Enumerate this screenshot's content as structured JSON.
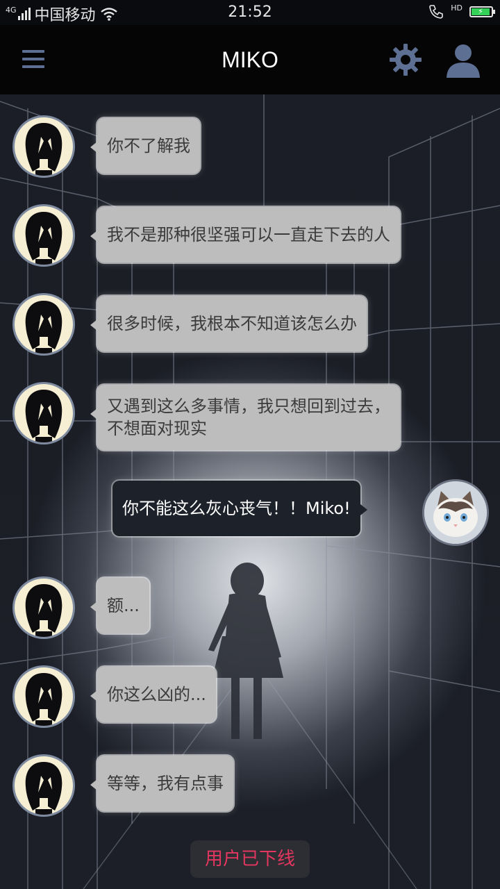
{
  "status_bar": {
    "network": "4G",
    "carrier": "中国移动",
    "time": "21:52",
    "hd": "HD",
    "battery_icon": "battery-charging-icon",
    "wifi_icon": "wifi-icon"
  },
  "header": {
    "title": "MIKO",
    "menu_icon": "menu-icon",
    "settings_icon": "gear-icon",
    "profile_icon": "user-icon"
  },
  "messages": [
    {
      "sender": "miko",
      "lines": [
        "你不了解我"
      ]
    },
    {
      "sender": "miko",
      "lines": [
        "我不是那种很坚强可以一直走下去的人"
      ]
    },
    {
      "sender": "miko",
      "lines": [
        "很多时候，我根本不知道该怎么办"
      ]
    },
    {
      "sender": "miko",
      "lines": [
        "又遇到这么多事情，我只想回到过去，",
        "不想面对现实"
      ]
    },
    {
      "sender": "user",
      "lines": [
        "你不能这么灰心丧气！！Miko!"
      ]
    },
    {
      "sender": "miko",
      "lines": [
        "额..."
      ]
    },
    {
      "sender": "miko",
      "lines": [
        "你这么凶的..."
      ]
    },
    {
      "sender": "miko",
      "lines": [
        "等等，我有点事"
      ]
    }
  ],
  "system_notice": "用户已下线",
  "colors": {
    "accent_icon": "#5d6f92",
    "incoming_bubble": "#bdbdbd",
    "outgoing_bubble": "#1d2129",
    "offline_text": "#e4365f"
  }
}
